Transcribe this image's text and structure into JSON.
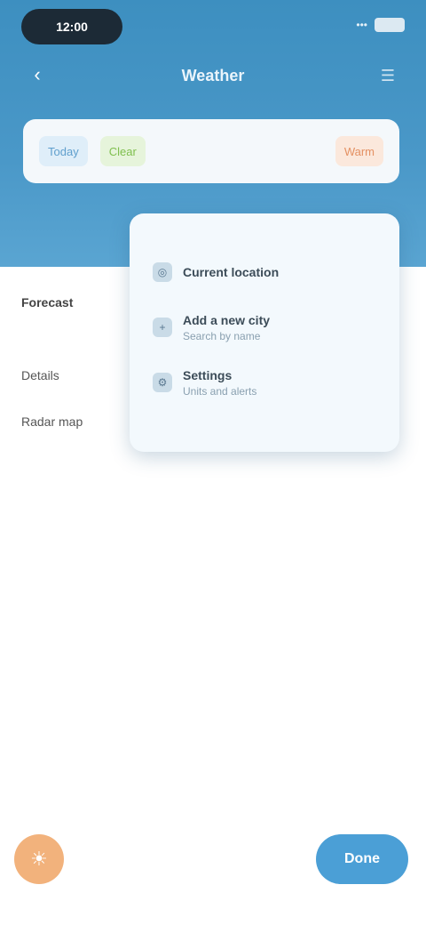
{
  "status_bar": {
    "time": "12:00",
    "signal": "•••",
    "battery_label": ""
  },
  "header": {
    "back_icon": "chevron-left-icon",
    "title": "Weather",
    "menu_icon": "menu-icon"
  },
  "search": {
    "chips": [
      {
        "label": "Today",
        "color": "blue"
      },
      {
        "label": "Clear",
        "color": "green"
      },
      {
        "label": "Warm",
        "color": "orange"
      }
    ]
  },
  "left_list": {
    "items": [
      {
        "label": "Forecast",
        "bold": true
      },
      {
        "label": "Details",
        "bold": false
      },
      {
        "label": "Radar map",
        "bold": false
      }
    ]
  },
  "dropdown": {
    "items": [
      {
        "title": "Current location",
        "sub": ""
      },
      {
        "title": "Add a new city",
        "sub": "Search by name"
      },
      {
        "title": "Settings",
        "sub": "Units and alerts"
      }
    ]
  },
  "bottom": {
    "left_icon": "sun-icon",
    "right_label": "Done"
  },
  "colors": {
    "header": "#3d8fc0",
    "primary_button": "#4b9fd6",
    "accent_orange": "#f2b27c"
  }
}
